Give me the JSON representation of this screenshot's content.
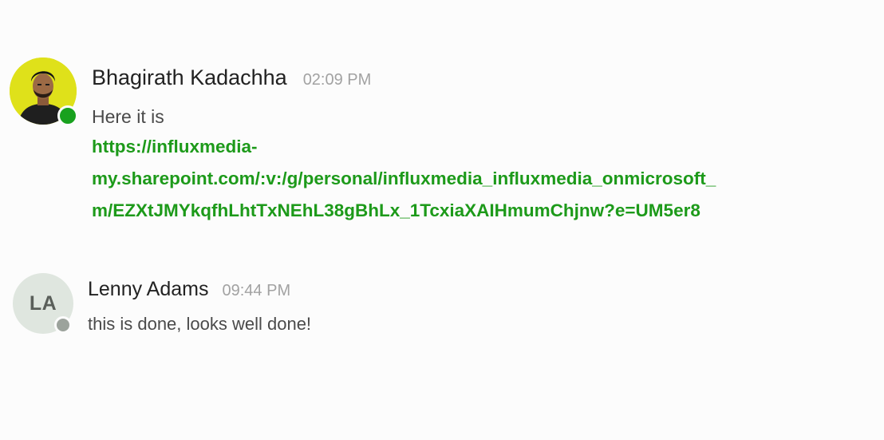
{
  "messages": [
    {
      "sender": "Bhagirath Kadachha",
      "time": "02:09 PM",
      "text": "Here it is",
      "link_lines": [
        "https://influxmedia-",
        "my.sharepoint.com/:v:/g/personal/influxmedia_influxmedia_onmicrosoft_",
        "m/EZXtJMYkqfhLhtTxNEhL38gBhLx_1TcxiaXAIHmumChjnw?e=UM5er8"
      ],
      "avatar": {
        "type": "photo",
        "bg_color": "#dfe11a"
      },
      "status": {
        "state": "online",
        "color": "#18a11e"
      }
    },
    {
      "sender": "Lenny Adams",
      "time": "09:44 PM",
      "text": "this is done, looks well done!",
      "avatar": {
        "type": "initials",
        "initials": "LA",
        "bg_color": "#dfe6df"
      },
      "status": {
        "state": "offline",
        "color": "#9ca39c"
      }
    }
  ],
  "colors": {
    "link": "#1d9a1a",
    "timestamp": "#a2a2a2",
    "background": "#fcfcfc"
  }
}
